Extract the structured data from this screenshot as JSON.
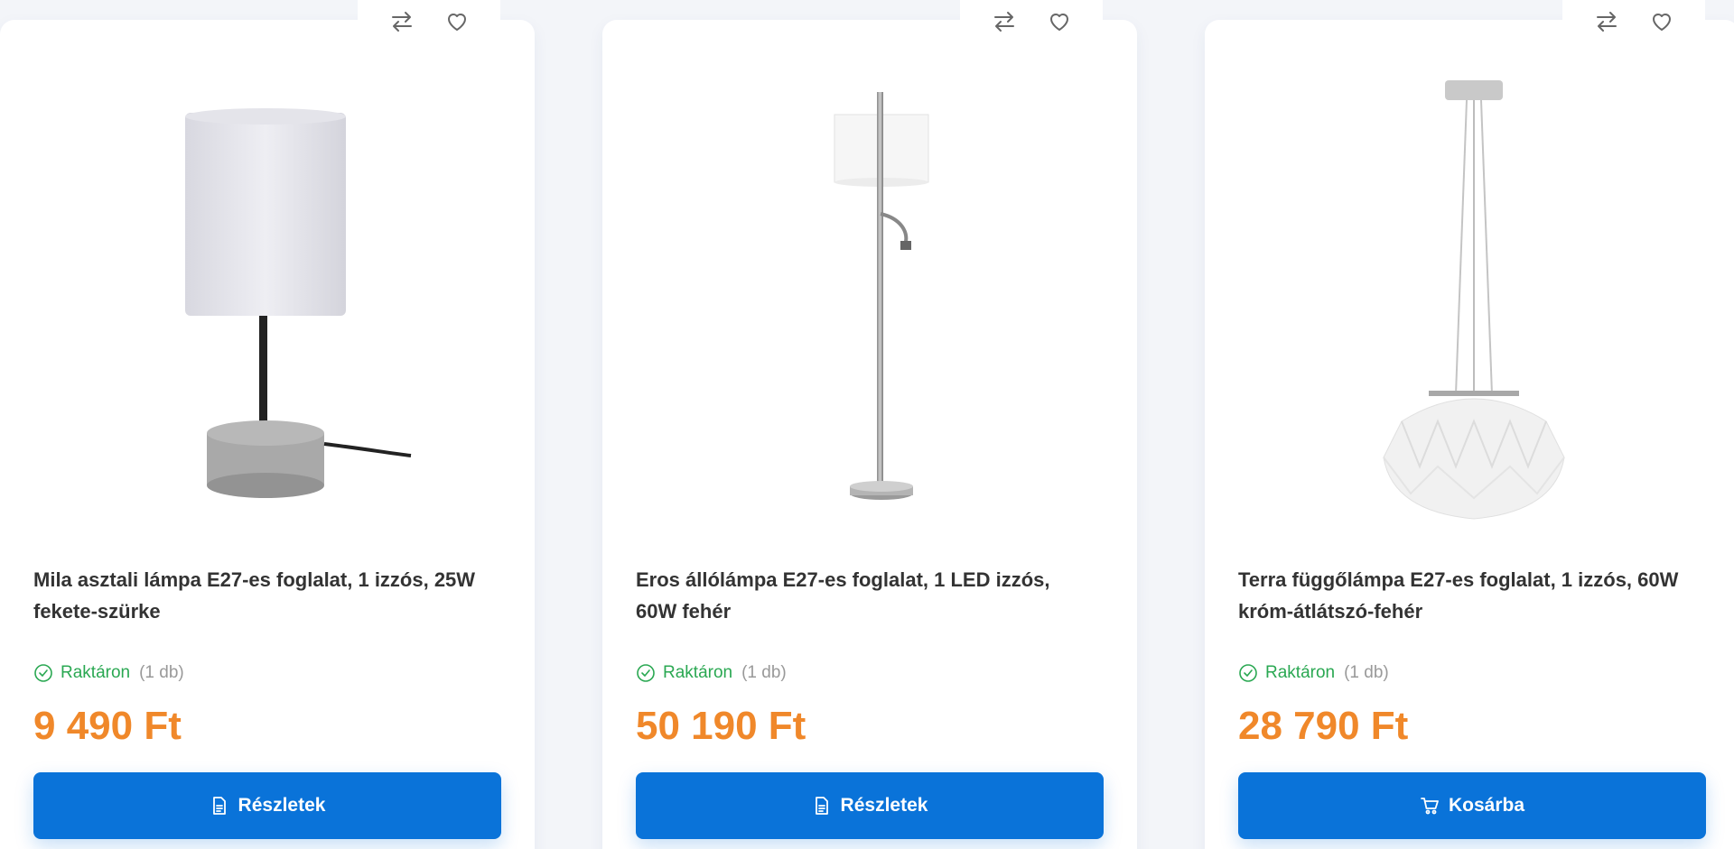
{
  "products": [
    {
      "title": "Mila asztali lámpa E27-es foglalat, 1 izzós, 25W fekete-szürke",
      "stock_label": "Raktáron",
      "stock_qty": "(1 db)",
      "price": "9 490 Ft",
      "button_label": "Részletek",
      "button_icon": "document-icon"
    },
    {
      "title": "Eros állólámpa E27-es foglalat, 1 LED izzós, 60W fehér",
      "stock_label": "Raktáron",
      "stock_qty": "(1 db)",
      "price": "50 190 Ft",
      "button_label": "Részletek",
      "button_icon": "document-icon"
    },
    {
      "title": "Terra függőlámpa E27-es foglalat, 1 izzós, 60W króm-átlátszó-fehér",
      "stock_label": "Raktáron",
      "stock_qty": "(1 db)",
      "price": "28 790 Ft",
      "button_label": "Kosárba",
      "button_icon": "cart-icon"
    }
  ],
  "colors": {
    "accent": "#0a73d9",
    "price": "#f0882a",
    "in_stock": "#2aa852"
  },
  "icons": {
    "compare": "compare-arrows-icon",
    "wishlist": "heart-icon",
    "stock": "check-circle-icon"
  }
}
